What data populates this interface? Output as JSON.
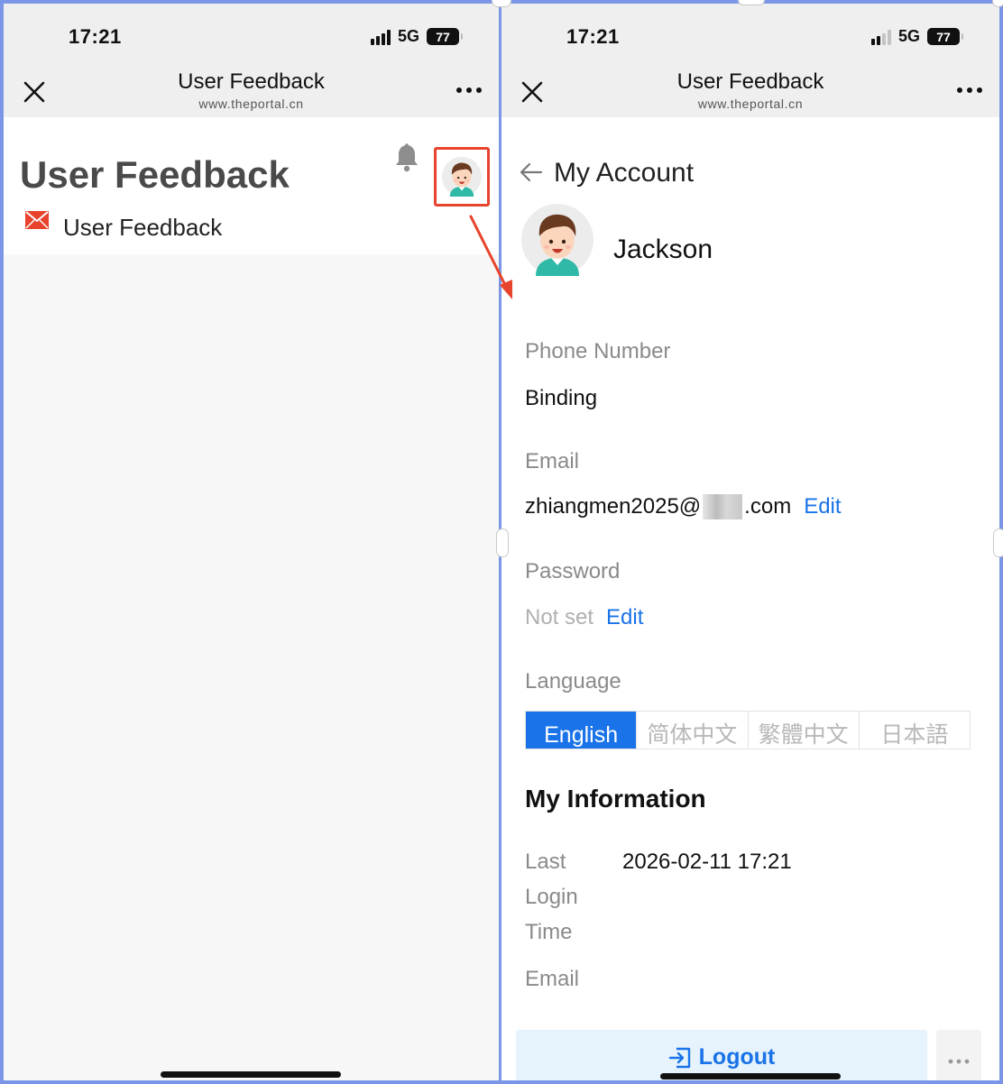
{
  "accent_color": "#1a73e8",
  "highlight_color": "#e8432c",
  "status_bar": {
    "time": "17:21",
    "network": "5G",
    "battery": "77"
  },
  "nav_bar": {
    "title": "User Feedback",
    "url": "www.theportal.cn"
  },
  "left_screen": {
    "page_title": "User Feedback",
    "menu_item": "User Feedback"
  },
  "right_screen": {
    "heading": "My Account",
    "user_name": "Jackson",
    "phone": {
      "label": "Phone Number",
      "action": "Binding"
    },
    "email": {
      "label": "Email",
      "value_prefix": "zhiangmen2025@",
      "value_suffix": ".com",
      "action": "Edit"
    },
    "password": {
      "label": "Password",
      "value": "Not set",
      "action": "Edit"
    },
    "language": {
      "label": "Language",
      "options": [
        "English",
        "简体中文",
        "繁體中文",
        "日本語"
      ],
      "selected": "English"
    },
    "my_information": {
      "title": "My Information",
      "rows": [
        {
          "label": "Last Login Time",
          "value": "2026-02-11 17:21"
        },
        {
          "label": "Email",
          "value": ""
        }
      ]
    },
    "logout_label": "Logout"
  }
}
